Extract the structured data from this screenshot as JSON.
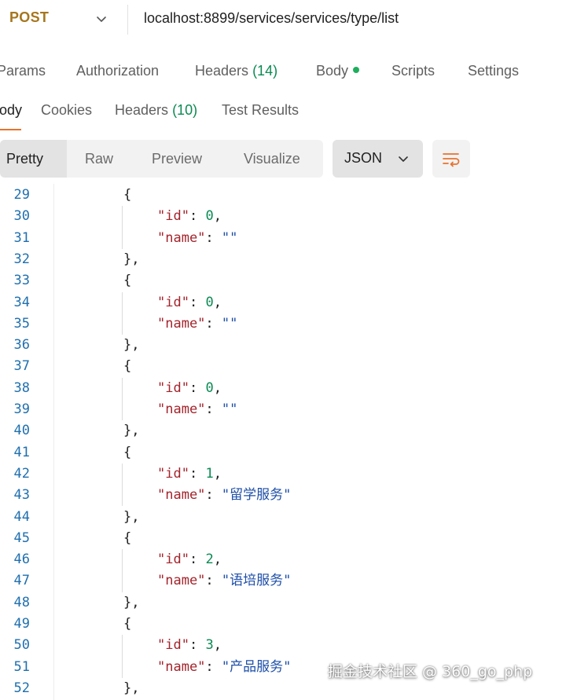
{
  "request": {
    "method": "POST",
    "url": "localhost:8899/services/services/type/list"
  },
  "request_tabs": {
    "params": "Params",
    "authorization": "Authorization",
    "headers": "Headers",
    "headers_count": "(14)",
    "body": "Body",
    "scripts": "Scripts",
    "settings": "Settings"
  },
  "response_tabs": {
    "body": "ody",
    "cookies": "Cookies",
    "headers": "Headers",
    "headers_count": "(10)",
    "test_results": "Test Results"
  },
  "view_modes": {
    "pretty": "Pretty",
    "raw": "Raw",
    "preview": "Preview",
    "visualize": "Visualize",
    "active": "Pretty"
  },
  "format": {
    "selected": "JSON"
  },
  "code_lines": [
    {
      "n": "29",
      "text": "{"
    },
    {
      "n": "30",
      "key": "\"id\"",
      "value": "0",
      "value_type": "number",
      "trailing": ","
    },
    {
      "n": "31",
      "key": "\"name\"",
      "value": "\"\"",
      "value_type": "string",
      "trailing": ""
    },
    {
      "n": "32",
      "text": "},"
    },
    {
      "n": "33",
      "text": "{"
    },
    {
      "n": "34",
      "key": "\"id\"",
      "value": "0",
      "value_type": "number",
      "trailing": ","
    },
    {
      "n": "35",
      "key": "\"name\"",
      "value": "\"\"",
      "value_type": "string",
      "trailing": ""
    },
    {
      "n": "36",
      "text": "},"
    },
    {
      "n": "37",
      "text": "{"
    },
    {
      "n": "38",
      "key": "\"id\"",
      "value": "0",
      "value_type": "number",
      "trailing": ","
    },
    {
      "n": "39",
      "key": "\"name\"",
      "value": "\"\"",
      "value_type": "string",
      "trailing": ""
    },
    {
      "n": "40",
      "text": "},"
    },
    {
      "n": "41",
      "text": "{"
    },
    {
      "n": "42",
      "key": "\"id\"",
      "value": "1",
      "value_type": "number",
      "trailing": ","
    },
    {
      "n": "43",
      "key": "\"name\"",
      "value": "\"留学服务\"",
      "value_type": "string",
      "trailing": ""
    },
    {
      "n": "44",
      "text": "},"
    },
    {
      "n": "45",
      "text": "{"
    },
    {
      "n": "46",
      "key": "\"id\"",
      "value": "2",
      "value_type": "number",
      "trailing": ","
    },
    {
      "n": "47",
      "key": "\"name\"",
      "value": "\"语培服务\"",
      "value_type": "string",
      "trailing": ""
    },
    {
      "n": "48",
      "text": "},"
    },
    {
      "n": "49",
      "text": "{"
    },
    {
      "n": "50",
      "key": "\"id\"",
      "value": "3",
      "value_type": "number",
      "trailing": ","
    },
    {
      "n": "51",
      "key": "\"name\"",
      "value": "\"产品服务\"",
      "value_type": "string",
      "trailing": ""
    },
    {
      "n": "52",
      "text": "},"
    }
  ],
  "watermark": "掘金技术社区 @ 360_go_php",
  "colors": {
    "method": "#a6761d",
    "accent": "#e8732c",
    "count": "#0b8a52",
    "key": "#a3242c",
    "number": "#0b8a52",
    "string": "#1e4fa8",
    "line_number": "#1f6fae",
    "status_dot": "#1fae5c"
  },
  "icons": {
    "method_dropdown": "chevron-down-icon",
    "format_dropdown": "chevron-down-icon",
    "wrap": "text-wrap-icon"
  }
}
